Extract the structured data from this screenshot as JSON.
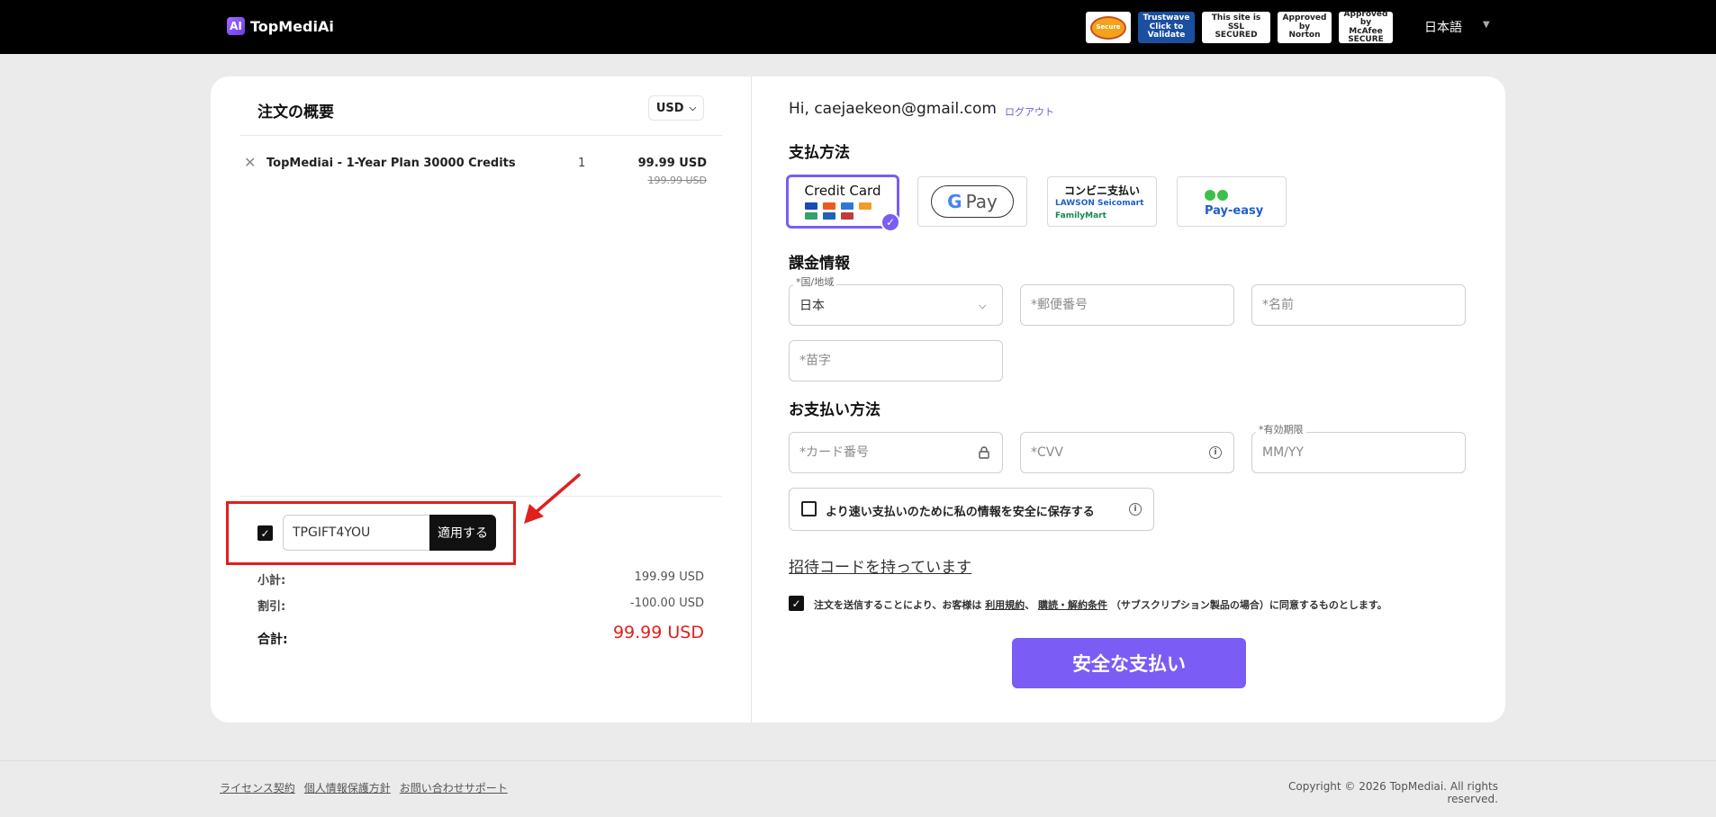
{
  "header": {
    "logo_text": "TopMedi",
    "logo_ai": "Ai",
    "logo_mark": "AI",
    "language": "日本語",
    "badges": [
      {
        "name": "mcafee-secure-seal",
        "label": "Secure"
      },
      {
        "name": "trustwave-badge",
        "label": "Trustwave\nClick to Validate"
      },
      {
        "name": "ssl-secured-badge",
        "label": "This site is SSL\nSECURED"
      },
      {
        "name": "norton-badge",
        "label": "Approved by\nNorton"
      },
      {
        "name": "mcafee-badge",
        "label": "Approved by\nMcAfee SECURE"
      }
    ]
  },
  "summary": {
    "title": "注文の概要",
    "currency": "USD",
    "item": {
      "name": "TopMediai - 1-Year Plan 30000 Credits",
      "qty": "1",
      "price": "99.99 USD",
      "old_price": "199.99 USD"
    },
    "coupon": {
      "code": "TPGIFT4YOU",
      "apply_label": "適用する"
    },
    "subtotal_label": "小計:",
    "subtotal": "199.99 USD",
    "discount_label": "割引:",
    "discount": "-100.00 USD",
    "total_label": "合計:",
    "total": "99.99 USD"
  },
  "form": {
    "greeting": "Hi, caejaekeon@gmail.com",
    "logout": "ログアウト",
    "payment_method_title": "支払方法",
    "payment_options": {
      "credit_card": "Credit Card",
      "google_pay": "Pay",
      "google_g": "G",
      "konbini_title": "コンビニ支払い",
      "konbini_line1": "LAWSON  Seicomart",
      "konbini_line2": "FamilyMart",
      "payeasy": "Pay-easy"
    },
    "billing_title": "課金情報",
    "country_label": "*国/地域",
    "country_value": "日本",
    "postal_placeholder": "*郵便番号",
    "firstname_placeholder": "*名前",
    "lastname_placeholder": "*苗字",
    "card_title": "お支払い方法",
    "card_number_placeholder": "*カード番号",
    "cvv_placeholder": "*CVV",
    "expiry_label": "*有効期限",
    "expiry_placeholder": "MM/YY",
    "save_label": "より速い支払いのために私の情報を安全に保存する",
    "invite_label": "招待コードを持っています",
    "terms_pre": "注文を送信することにより、お客様は",
    "terms_link1": "利用規約",
    "terms_sep": "、",
    "terms_link2": "購読・解約条件",
    "terms_post": "（サブスクリプション製品の場合）に同意するものとします。",
    "pay_button": "安全な支払い"
  },
  "footer": {
    "links": [
      "ライセンス契約",
      "個人情報保護方針",
      "お問い合わせサポート"
    ],
    "copyright": "Copyright © 2026 TopMediai. All rights reserved."
  },
  "colors": {
    "accent": "#7b5cf5",
    "highlight": "#e0201d",
    "total": "#e0201d"
  }
}
